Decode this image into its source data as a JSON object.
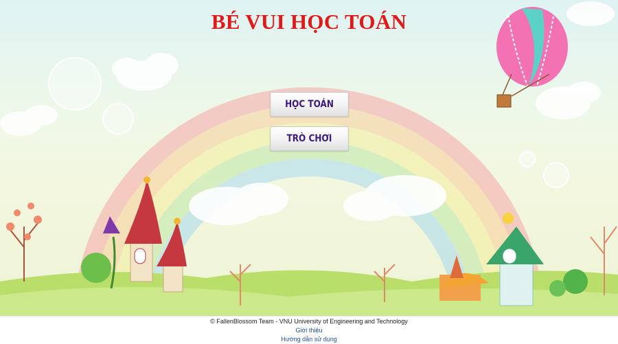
{
  "header": {
    "title": "BÉ VUI HỌC TOÁN"
  },
  "menu": {
    "learn_label": "HỌC TOÁN",
    "games_label": "TRÒ CHƠI"
  },
  "footer": {
    "copyright": "© FallenBlossom Team - VNU University of Engineering and Technology",
    "about_link": "Giới thiệu",
    "guide_link": "Hướng dẫn sử dụng"
  },
  "colors": {
    "title": "#e01919",
    "button_text": "#3b1a7a",
    "link": "#1f4fa8"
  }
}
